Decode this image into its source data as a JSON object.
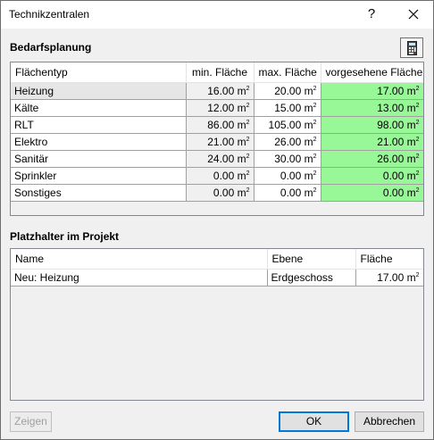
{
  "window": {
    "title": "Technikzentralen",
    "help": "?"
  },
  "bedarfsplanung": {
    "title": "Bedarfsplanung",
    "columns": [
      "Flächentyp",
      "min. Fläche",
      "max. Fläche",
      "vorgesehene Fläche"
    ],
    "unit": "m",
    "unit_exp": "2",
    "rows": [
      {
        "typ": "Heizung",
        "min": "16.00",
        "max": "20.00",
        "vorg": "17.00"
      },
      {
        "typ": "Kälte",
        "min": "12.00",
        "max": "15.00",
        "vorg": "13.00"
      },
      {
        "typ": "RLT",
        "min": "86.00",
        "max": "105.00",
        "vorg": "98.00"
      },
      {
        "typ": "Elektro",
        "min": "21.00",
        "max": "26.00",
        "vorg": "21.00"
      },
      {
        "typ": "Sanitär",
        "min": "24.00",
        "max": "30.00",
        "vorg": "26.00"
      },
      {
        "typ": "Sprinkler",
        "min": "0.00",
        "max": "0.00",
        "vorg": "0.00"
      },
      {
        "typ": "Sonstiges",
        "min": "0.00",
        "max": "0.00",
        "vorg": "0.00"
      }
    ]
  },
  "platzhalter": {
    "title": "Platzhalter im Projekt",
    "columns": [
      "Name",
      "Ebene",
      "Fläche"
    ],
    "rows": [
      {
        "name": "Neu: Heizung",
        "ebene": "Erdgeschoss",
        "flaeche": "17.00"
      }
    ]
  },
  "buttons": {
    "zeigen": "Zeigen",
    "ok": "OK",
    "abbrechen": "Abbrechen"
  },
  "colors": {
    "vorgesehen_bg": "#98f898",
    "accent": "#0078d7"
  }
}
